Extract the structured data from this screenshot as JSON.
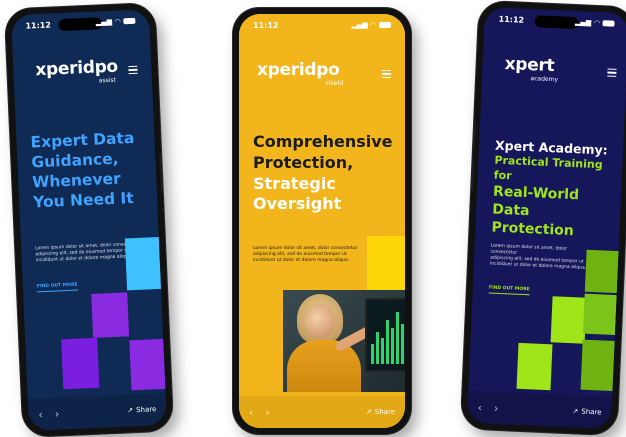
{
  "phones": [
    {
      "time": "11:12",
      "logo": "xperidpo",
      "logo_sub": "assist",
      "headline_lines": [
        "Expert Data",
        "Guidance,",
        "Whenever",
        "You Need It"
      ],
      "lorem": [
        "Lorem ipsum dolor sit amet, dolor consectetur",
        "adipiscing elit, sed do eiusmod tempor ut",
        "incididunt ut dolor et dolore magna aliqua."
      ],
      "cta": "FIND OUT MORE",
      "share": "Share",
      "colors": {
        "bg": "#0f2a55",
        "headline": "#3fa3ff",
        "block1": "#3fc0ff",
        "block2": "#8a2be2",
        "block3": "#7a1fe0"
      }
    },
    {
      "time": "11:12",
      "logo": "xperidpo",
      "logo_sub": "shield",
      "headline_lines": [
        "Comprehensive",
        "Protection,",
        "Strategic",
        "Oversight"
      ],
      "lorem": [
        "Lorem ipsum dolor sit amet, dolor consectetur",
        "adipiscing elit, sed do eiusmod tempor ut",
        "incididunt ut dolor et dolore magna aliqua."
      ],
      "cta": "",
      "share": "Share",
      "colors": {
        "bg": "#f2b51c",
        "headline": "#1b1b1b",
        "block1": "#ffd60a"
      }
    },
    {
      "time": "11:12",
      "logo": "xpert",
      "logo_sub": "academy",
      "headline_lines": [
        "Xpert Academy:",
        "Practical Training for",
        "Real-World Data",
        "Protection"
      ],
      "lorem": [
        "Lorem ipsum dolor sit amet, dolor consectetur",
        "adipiscing elit, sed do eiusmod tempor ut",
        "incididunt ut dolor et dolore magna aliqua."
      ],
      "cta": "FIND OUT MORE",
      "share": "Share",
      "colors": {
        "bg": "#16175a",
        "headline_white": "#ffffff",
        "headline_green": "#9fe51a",
        "block1": "#9fe51a",
        "block2": "#6fb313"
      }
    }
  ]
}
